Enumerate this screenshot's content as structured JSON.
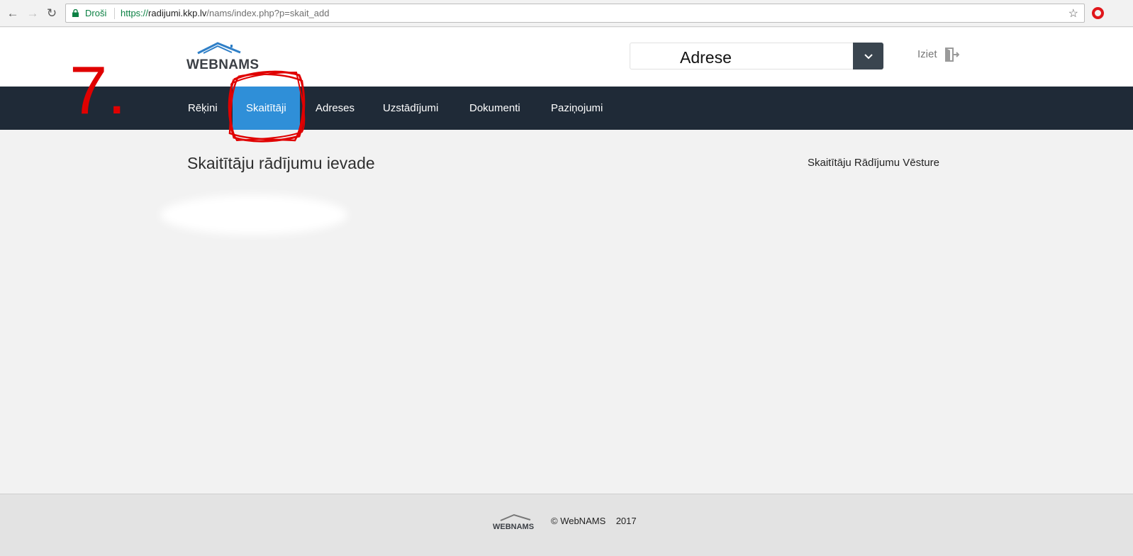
{
  "browser": {
    "secure_label": "Droši",
    "url_scheme": "https://",
    "url_host": "radijumi.kkp.lv",
    "url_path": "/nams/index.php?p=skait_add"
  },
  "header": {
    "logo_text": "WEBNAMS",
    "address_label": "Adrese",
    "logout_label": "Iziet"
  },
  "nav": {
    "items": [
      {
        "label": "Rēķini",
        "active": false
      },
      {
        "label": "Skaitītāji",
        "active": true
      },
      {
        "label": "Adreses",
        "active": false
      },
      {
        "label": "Uzstādījumi",
        "active": false
      },
      {
        "label": "Dokumenti",
        "active": false
      },
      {
        "label": "Paziņojumi",
        "active": false
      }
    ]
  },
  "main": {
    "title": "Skaitītāju rādījumu ievade",
    "history_link": "Skaitītāju Rādījumu Vēsture"
  },
  "annotation": {
    "step": "7.",
    "color": "#e00000"
  },
  "footer": {
    "logo_text": "WEBNAMS",
    "copyright": "© WebNAMS    2017"
  },
  "colors": {
    "nav_bg": "#1f2a37",
    "nav_active": "#2f8fd8",
    "select_toggle": "#3a454f"
  }
}
